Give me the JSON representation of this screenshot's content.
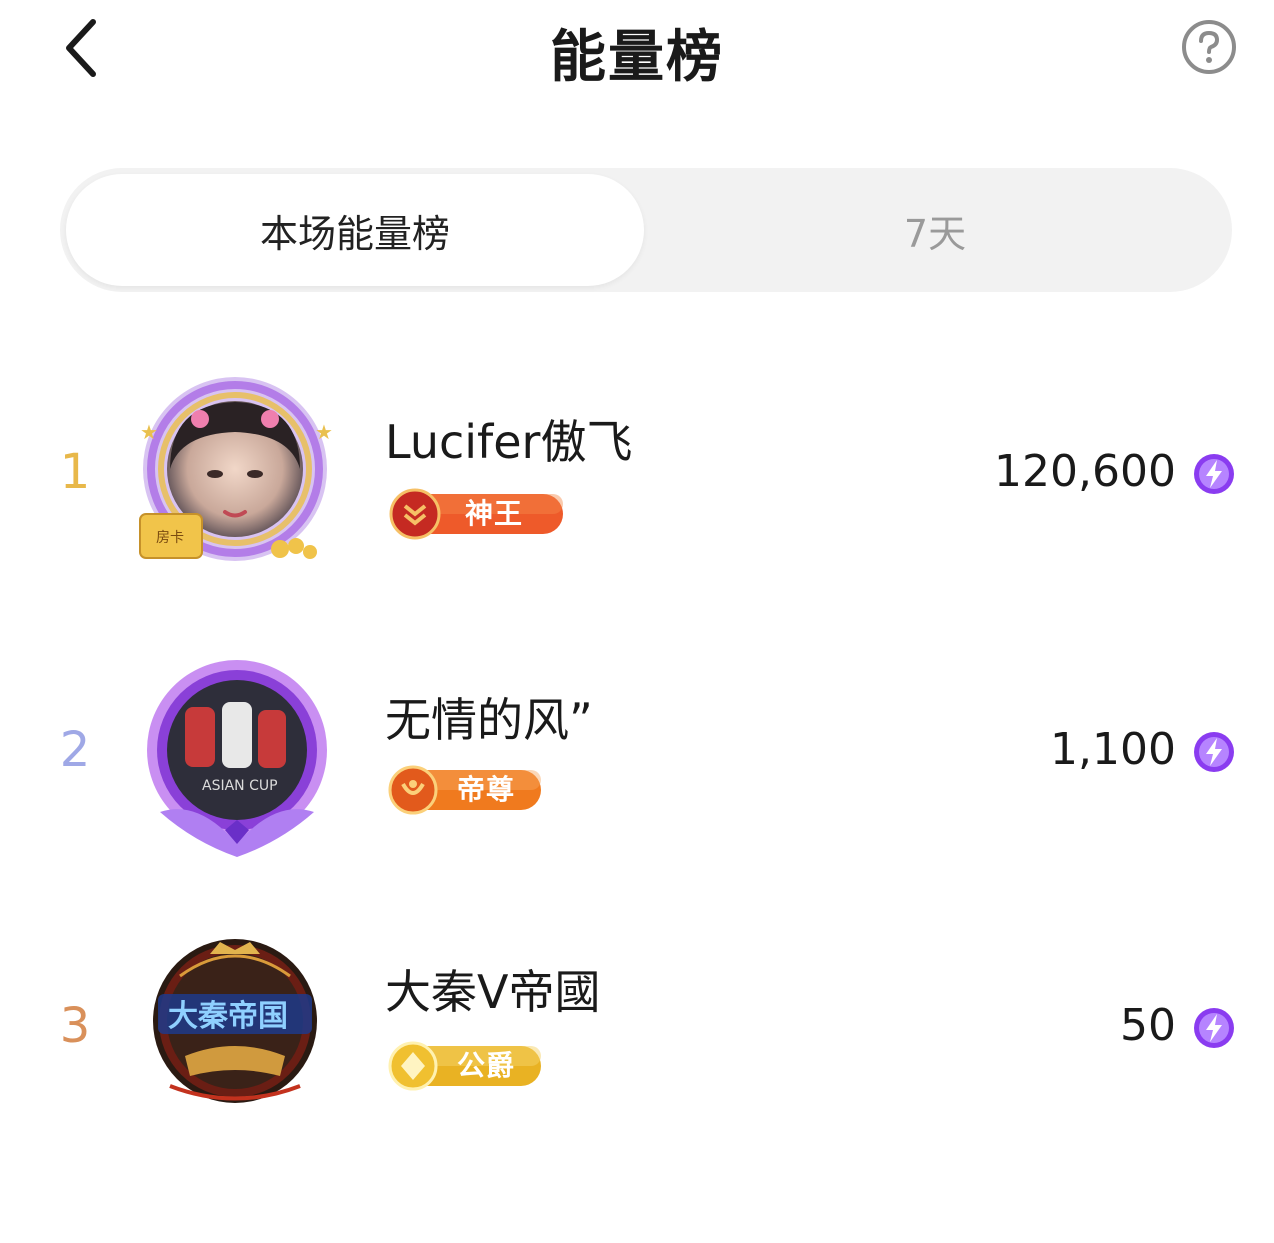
{
  "header": {
    "title": "能量榜"
  },
  "tabs": [
    {
      "label": "本场能量榜",
      "active": true
    },
    {
      "label": "7天",
      "active": false
    }
  ],
  "ranking": [
    {
      "rank": "1",
      "name": "Lucifer傲飞",
      "badge": "神王",
      "score": "120,600",
      "rank_color": "#e8b84a"
    },
    {
      "rank": "2",
      "name": "无情的风”",
      "badge": "帝尊",
      "score": "1,100",
      "rank_color": "#9fa8e6"
    },
    {
      "rank": "3",
      "name": "大秦V帝國",
      "badge": "公爵",
      "score": "50",
      "rank_color": "#d9905a"
    }
  ],
  "avatar_texts": {
    "card_label": "房卡",
    "asian_cup": "ASIAN CUP",
    "empire": "大秦帝国"
  },
  "colors": {
    "energy_purple": "#8a3cf0",
    "badge_red": "#e2452a",
    "badge_orange": "#f07a1e",
    "badge_gold": "#e9b223"
  },
  "icons": {
    "back": "chevron-left-icon",
    "help": "question-circle-icon",
    "energy": "lightning-bolt-icon"
  }
}
